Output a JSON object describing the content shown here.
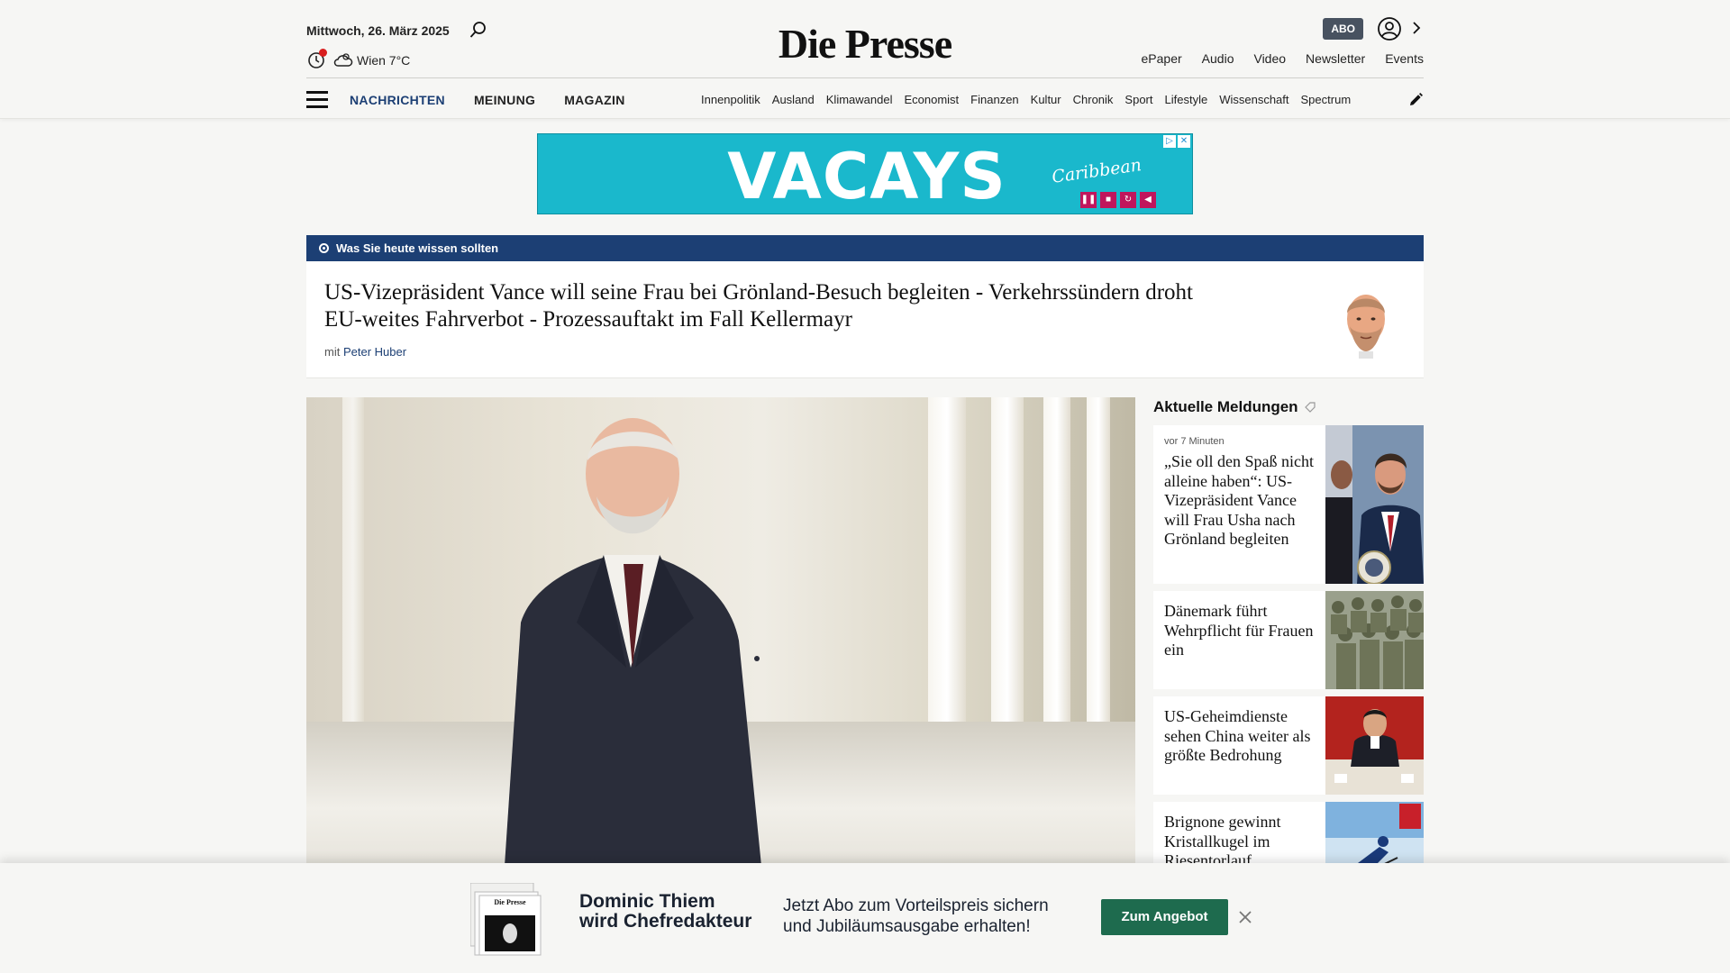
{
  "header": {
    "date": "Mittwoch, 26. März 2025",
    "weather": "Wien 7°C",
    "logo": "Die Presse",
    "abo": "ABO",
    "top_links": [
      "ePaper",
      "Audio",
      "Video",
      "Newsletter",
      "Events"
    ],
    "main_nav": [
      "NACHRICHTEN",
      "MEINUNG",
      "MAGAZIN"
    ],
    "section_nav": [
      "Innenpolitik",
      "Ausland",
      "Klimawandel",
      "Economist",
      "Finanzen",
      "Kultur",
      "Chronik",
      "Sport",
      "Lifestyle",
      "Wissenschaft",
      "Spectrum"
    ]
  },
  "ad": {
    "headline": "VACAYS",
    "badge": "Caribbean"
  },
  "briefing": {
    "label": "Was Sie heute wissen sollten",
    "title": "US-Vizepräsident Vance will seine Frau bei Grönland-Besuch begleiten - Verkehrssündern droht EU-weites Fahrverbot - Prozessauftakt im Fall Kellermayr",
    "author_prefix": "mit",
    "author": "Peter Huber"
  },
  "sidebar": {
    "title": "Aktuelle Meldungen",
    "items": [
      {
        "time": "vor 7 Minuten",
        "title": "„Sie oll den Spaß nicht alleine haben“: US-Vizepräsident Vance will Frau Usha nach Grönland begleiten"
      },
      {
        "title": "Dänemark führt Wehrpflicht für Frauen ein"
      },
      {
        "title": "US-Geheimdienste sehen China weiter als größte Bedrohung"
      },
      {
        "title": "Brignone gewinnt Kristallkugel im Riesentorlauf"
      }
    ]
  },
  "promo": {
    "headline_1": "Dominic Thiem",
    "headline_2": "wird Chefredakteur",
    "text_1": "Jetzt Abo zum Vorteilspreis sichern",
    "text_2": "und Jubiläumsausgabe erhalten!",
    "button": "Zum Angebot"
  },
  "colors": {
    "navy": "#1c3f74",
    "promo_green": "#1e6b4e",
    "ad_cyan": "#1ab8cc"
  }
}
